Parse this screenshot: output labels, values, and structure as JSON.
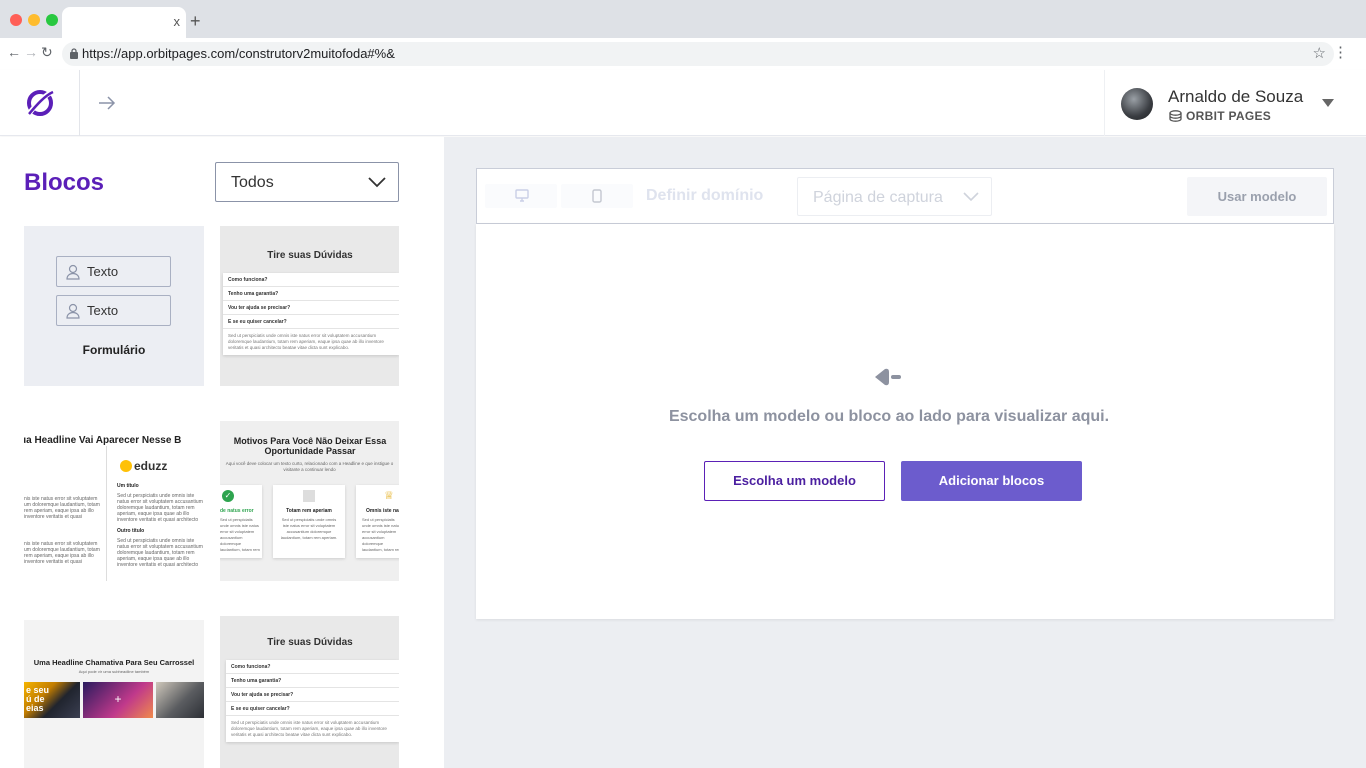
{
  "browser": {
    "tab_close": "x",
    "new_tab": "+",
    "url": "https://app.orbitpages.com/construtorv2muitofoda#%&"
  },
  "header": {
    "user_name": "Arnaldo de Souza",
    "org_name": "ORBIT PAGES"
  },
  "sidebar": {
    "title": "Blocos",
    "filter_value": "Todos",
    "blocks": {
      "form": {
        "field1": "Texto",
        "field2": "Texto",
        "label": "Formulário"
      },
      "faq1": {
        "title": "Tire suas Dúvidas",
        "questions": [
          "Como funciona?",
          "Tenho uma garantia?",
          "Vou ter ajuda se precisar?",
          "E se eu quiser cancelar?"
        ],
        "answer": "Sed ut perspiciatis unde omnis iste natus error sit voluptatem accusantium doloremque laudantium, totam rem aperiam, eaque ipsa quae ab illo inventore veritatis et quasi architecto beatae vitae dicta sunt explicabo."
      },
      "headline": {
        "title": "ua Headline Vai Aparecer Nesse B",
        "brand": "eduzz",
        "heading1": "Um título",
        "heading2": "Outro título",
        "body": "Sed ut perspiciatis unde omnis iste natus error sit voluptatem accusantium doloremque laudantium, totam rem aperiam, eaque ipsa quae ab illo inventore veritatis et quasi architecto beatae vitae dicta sunt explicabo.",
        "left_text": "nis iste natus error sit voluptatem um doloremque laudantium, totam rem aperiam, eaque ipsa ab illo inventore veritatis et quasi"
      },
      "motivos": {
        "title": "Motivos Para Você Não Deixar Essa Oportunidade Passar",
        "subtitle": "Aqui você deve colocar um texto curto, relacionado com a Headline e que instigue o visitante a continuar lendo",
        "card_left": "de natus error",
        "card_mid": "Totam rem aperiam",
        "card_right": "Omnis iste na",
        "card_body": "Sed ut perspiciatis unde omnis iste natus error sit voluptatem accusantium doloremque laudantium, totam rem aperiam."
      },
      "carousel": {
        "title": "Uma Headline Chamativa Para Seu Carrossel",
        "subtitle": "Aqui pode vir uma subheadline também",
        "img_text": "e seu ú de eias",
        "plus": "+"
      },
      "faq2": {
        "title": "Tire suas Dúvidas",
        "questions": [
          "Como funciona?",
          "Tenho uma garantia?",
          "Vou ter ajuda se precisar?",
          "E se eu quiser cancelar?"
        ],
        "answer": "Sed ut perspiciatis unde omnis iste natus error sit voluptatem accusantium doloremque laudantium, totam rem aperiam, eaque ipsa quae ab illo inventore veritatis et quasi architecto beatae vitae dicta sunt explicabo."
      }
    }
  },
  "toolbar": {
    "domain_label": "Definir domínio",
    "page_type": "Página de captura",
    "use_model": "Usar modelo"
  },
  "canvas": {
    "message": "Escolha um modelo ou bloco ao lado para visualizar aqui.",
    "choose_model": "Escolha um modelo",
    "add_blocks": "Adicionar blocos"
  },
  "colors": {
    "brand": "#5b1fb8",
    "button": "#6c5ccd",
    "canvas_bg": "#eceef2"
  }
}
